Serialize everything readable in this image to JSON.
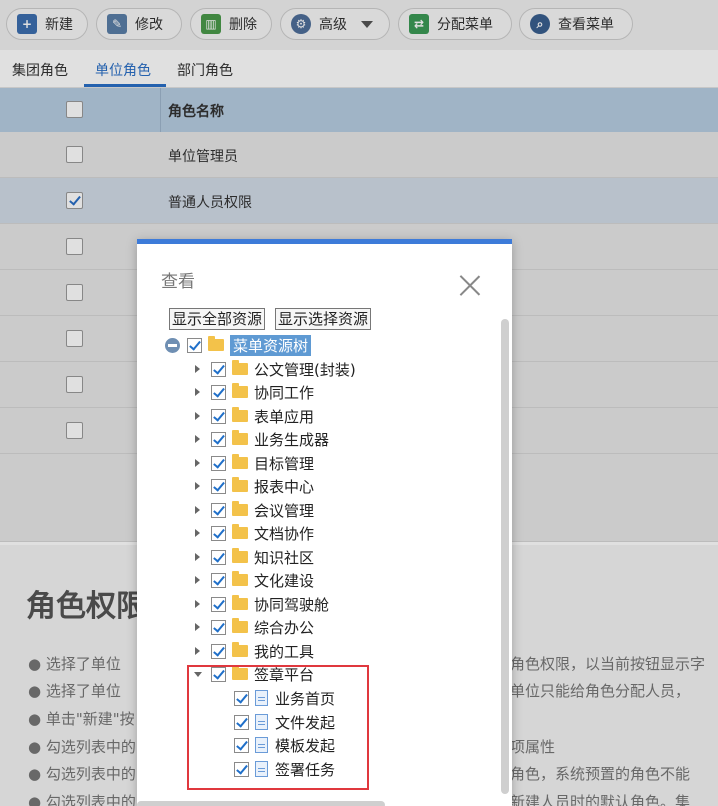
{
  "toolbar": {
    "buttons": [
      {
        "label": "新建",
        "icon": "new-icon",
        "color": "#3d6fb0"
      },
      {
        "label": "修改",
        "icon": "edit-icon",
        "color": "#5b7fa8"
      },
      {
        "label": "删除",
        "icon": "trash-icon",
        "color": "#4a9a4a"
      },
      {
        "label": "高级",
        "icon": "gear-icon",
        "color": "#4f6f9a"
      },
      {
        "label": "分配菜单",
        "icon": "assign-menu-icon",
        "color": "#3c9a56"
      },
      {
        "label": "查看菜单",
        "icon": "search-icon",
        "color": "#3a5f8f"
      }
    ]
  },
  "tabs": [
    "集团角色",
    "单位角色",
    "部门角色"
  ],
  "active_tab": "单位角色",
  "table": {
    "header": "角色名称",
    "rows": [
      {
        "name": "单位管理员",
        "checked": false
      },
      {
        "name": "普通人员权限",
        "checked": true
      },
      {
        "name": "",
        "checked": false
      },
      {
        "name": "",
        "checked": false
      },
      {
        "name": "",
        "checked": false
      },
      {
        "name": "",
        "checked": false
      },
      {
        "name": "",
        "checked": false
      }
    ]
  },
  "help": {
    "title": "角色权限",
    "lines_left": [
      "选择了单位",
      "选择了单位",
      "单击\"新建\"按",
      "勾选列表中的",
      "勾选列表中的",
      "勾选列表中的"
    ],
    "lines_right": [
      "角色权限，以当前按钮显示字",
      "单位只能给角色分配人员，",
      "",
      "项属性",
      "角色，系统预置的角色不能",
      "新建人员时的默认角色。集"
    ]
  },
  "dialog": {
    "title": "查看",
    "show_all_label": "显示全部资源",
    "show_selected_label": "显示选择资源",
    "root": "菜单资源树",
    "folders": [
      "公文管理(封装)",
      "协同工作",
      "表单应用",
      "业务生成器",
      "目标管理",
      "报表中心",
      "会议管理",
      "文档协作",
      "知识社区",
      "文化建设",
      "协同驾驶舱",
      "综合办公",
      "我的工具"
    ],
    "expanded_folder": "签章平台",
    "children": [
      "业务首页",
      "文件发起",
      "模板发起",
      "签署任务"
    ]
  }
}
